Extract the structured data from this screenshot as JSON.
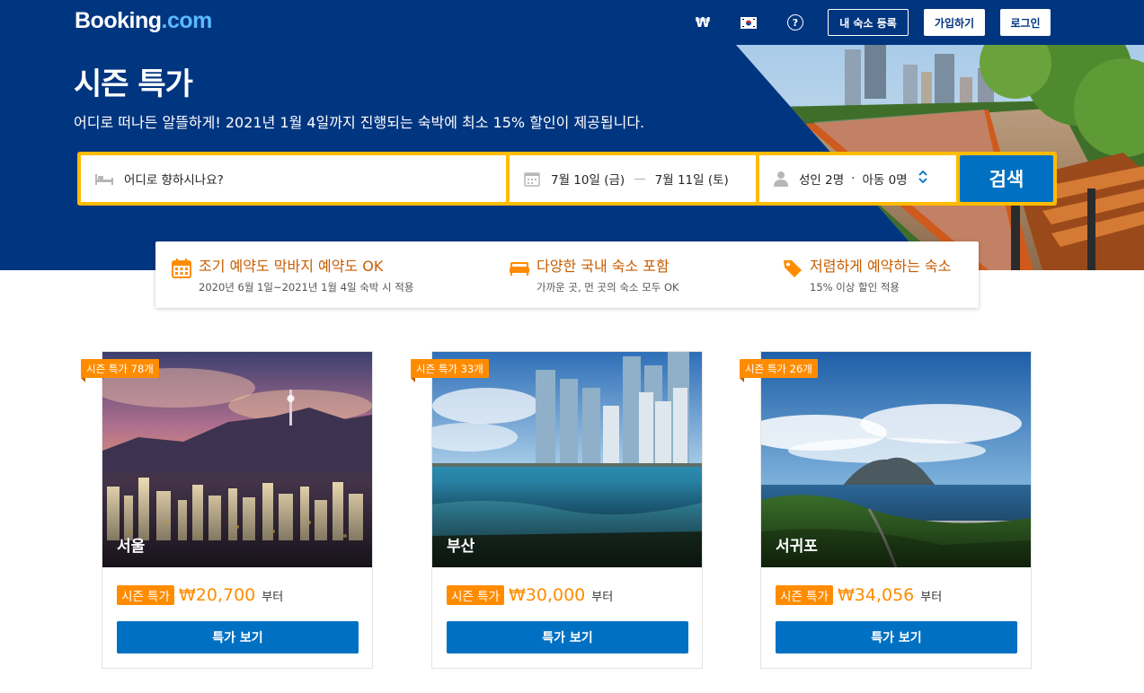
{
  "header": {
    "logo_main": "Booking",
    "logo_dot": ".",
    "logo_tld": "com",
    "currency_symbol": "₩",
    "help_symbol": "?",
    "list_property": "내 숙소 등록",
    "register": "가입하기",
    "sign_in": "로그인"
  },
  "hero": {
    "title": "시즌 특가",
    "subtitle": "어디로 떠나든 알뜰하게! 2021년 1월 4일까지 진행되는 숙박에 최소 15% 할인이 제공됩니다."
  },
  "search": {
    "destination_placeholder": "어디로 향하시나요?",
    "checkin": "7월 10일 (금)",
    "dash": "—",
    "checkout": "7월 11일 (토)",
    "adults": "성인 2명",
    "sep": "·",
    "children": "아동 0명",
    "button": "검색"
  },
  "features": [
    {
      "title": "조기 예약도 막바지 예약도 OK",
      "sub": "2020년 6월 1일~2021년 1월 4일 숙박 시 적용",
      "icon": "calendar-icon"
    },
    {
      "title": "다양한 국내 숙소 포함",
      "sub": "가까운 곳, 먼 곳의 숙소 모두 OK",
      "icon": "bed-icon"
    },
    {
      "title": "저렴하게 예약하는 숙소",
      "sub": "15% 이상 할인 적용",
      "icon": "price-tag-icon"
    }
  ],
  "cards": [
    {
      "city": "서울",
      "ribbon": "시즌 특가 78개",
      "tag": "시즌 특가",
      "price": "₩20,700",
      "from": "부터",
      "button": "특가 보기"
    },
    {
      "city": "부산",
      "ribbon": "시즌 특가 33개",
      "tag": "시즌 특가",
      "price": "₩30,000",
      "from": "부터",
      "button": "특가 보기"
    },
    {
      "city": "서귀포",
      "ribbon": "시즌 특가 26개",
      "tag": "시즌 특가",
      "price": "₩34,056",
      "from": "부터",
      "button": "특가 보기"
    }
  ],
  "colors": {
    "brand_blue": "#003580",
    "action_blue": "#0071c2",
    "search_border": "#febb02",
    "deal_orange": "#ff8c00",
    "feature_orange": "#c75d00"
  }
}
